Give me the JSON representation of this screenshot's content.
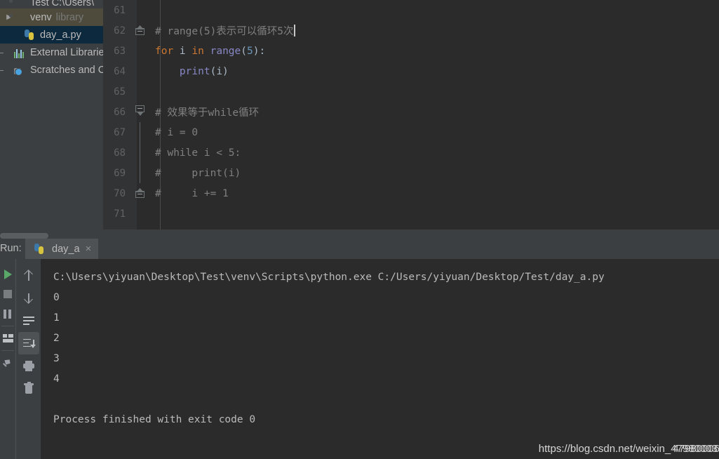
{
  "project_tree": {
    "items": [
      {
        "label": "Test C:\\Users\\",
        "suffix": "",
        "icon": "folder-icon",
        "state": "clipped",
        "arrow": ""
      },
      {
        "label": "venv",
        "suffix": "library",
        "icon": "folder-icon",
        "state": "hovered",
        "arrow": "▶"
      },
      {
        "label": "day_a.py",
        "suffix": "",
        "icon": "python-file-icon",
        "state": "selected",
        "arrow": ""
      },
      {
        "label": "External Librarie",
        "suffix": "",
        "icon": "external-libraries-icon",
        "state": "normal",
        "arrow": ""
      },
      {
        "label": "Scratches and C",
        "suffix": "",
        "icon": "scratches-icon",
        "state": "normal",
        "arrow": ""
      }
    ]
  },
  "editor": {
    "lines": [
      {
        "number": "61",
        "fold": "none",
        "tokens": []
      },
      {
        "number": "62",
        "fold": "house-up",
        "tokens": [
          {
            "t": "comment",
            "v": "# range(5)表示可以循环5次"
          }
        ],
        "cursor": true
      },
      {
        "number": "63",
        "fold": "none",
        "tokens": [
          {
            "t": "keyword",
            "v": "for"
          },
          {
            "t": "plain",
            "v": " i "
          },
          {
            "t": "keyword",
            "v": "in"
          },
          {
            "t": "plain",
            "v": " "
          },
          {
            "t": "function",
            "v": "range"
          },
          {
            "t": "punct",
            "v": "("
          },
          {
            "t": "number",
            "v": "5"
          },
          {
            "t": "punct",
            "v": "):"
          }
        ]
      },
      {
        "number": "64",
        "fold": "none",
        "tokens": [
          {
            "t": "plain",
            "v": "    "
          },
          {
            "t": "function",
            "v": "print"
          },
          {
            "t": "punct",
            "v": "("
          },
          {
            "t": "plain",
            "v": "i"
          },
          {
            "t": "punct",
            "v": ")"
          }
        ]
      },
      {
        "number": "65",
        "fold": "none",
        "tokens": []
      },
      {
        "number": "66",
        "fold": "tri-down",
        "tokens": [
          {
            "t": "comment",
            "v": "# 效果等于while循环"
          }
        ]
      },
      {
        "number": "67",
        "fold": "line",
        "tokens": [
          {
            "t": "comment",
            "v": "# i = 0"
          }
        ]
      },
      {
        "number": "68",
        "fold": "line",
        "tokens": [
          {
            "t": "comment",
            "v": "# while i < 5:"
          }
        ]
      },
      {
        "number": "69",
        "fold": "line",
        "tokens": [
          {
            "t": "comment",
            "v": "#     print(i)"
          }
        ]
      },
      {
        "number": "70",
        "fold": "house-up",
        "tokens": [
          {
            "t": "comment",
            "v": "#     i += 1"
          }
        ]
      },
      {
        "number": "71",
        "fold": "none",
        "tokens": []
      }
    ]
  },
  "run_panel": {
    "run_label": "Run:",
    "tab": {
      "title": "day_a",
      "icon": "python-file-icon",
      "close_label": "×"
    },
    "left_toolbar": [
      {
        "name": "rerun-button",
        "icon": "play-icon"
      },
      {
        "name": "stop-button",
        "icon": "stop-icon"
      },
      {
        "name": "pause-button",
        "icon": "pause-icon"
      },
      {
        "name": "layout-button",
        "icon": "grid-icon"
      },
      {
        "name": "pin-tab-button",
        "icon": "pin-icon"
      }
    ],
    "mid_toolbar": [
      {
        "name": "up-the-stack-trace-button",
        "icon": "arrow-up-icon",
        "active": false
      },
      {
        "name": "down-the-stack-trace-button",
        "icon": "arrow-down-icon",
        "active": false
      },
      {
        "name": "soft-wrap-button",
        "icon": "soft-wrap-icon",
        "active": false
      },
      {
        "name": "scroll-to-end-button",
        "icon": "scroll-to-end-icon",
        "active": true
      },
      {
        "name": "print-button",
        "icon": "printer-icon",
        "active": false
      },
      {
        "name": "clear-all-button",
        "icon": "trash-icon",
        "active": false
      }
    ],
    "console_lines": [
      "C:\\Users\\yiyuan\\Desktop\\Test\\venv\\Scripts\\python.exe C:/Users/yiyuan/Desktop/Test/day_a.py",
      "0",
      "1",
      "2",
      "3",
      "4",
      "",
      "Process finished with exit code 0"
    ]
  },
  "watermark": {
    "prefix": "https://blog.csdn.net/weixin_",
    "id_a": "47980003",
    "id_b": "47980006"
  },
  "colors": {
    "editor_bg": "#2B2B2B",
    "gutter_bg": "#313335",
    "panel_bg": "#3C3F41",
    "selection_blue": "#0D293E",
    "hover_olive": "#4E4B3D",
    "keyword_orange": "#CC7832",
    "function_purple": "#8888C6",
    "number_blue": "#6897BB",
    "comment_gray": "#808080",
    "text_gray": "#A9B7C6",
    "run_green": "#59A869"
  }
}
